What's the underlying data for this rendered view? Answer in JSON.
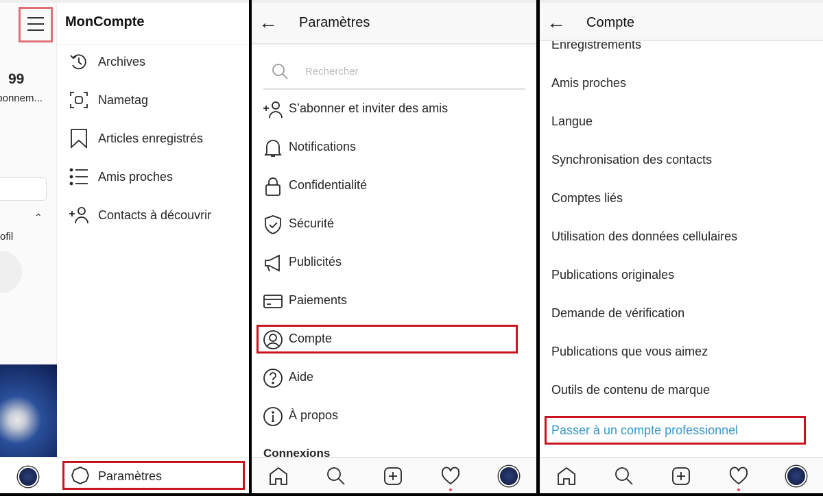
{
  "panel1": {
    "title": "MonCompte",
    "profile_count": "99",
    "profile_count_label": "bonnem...",
    "profile_partial_label": "ofil",
    "menu": [
      {
        "label": "Archives",
        "icon": "archive-history-icon"
      },
      {
        "label": "Nametag",
        "icon": "nametag-icon"
      },
      {
        "label": "Articles enregistrés",
        "icon": "bookmark-icon"
      },
      {
        "label": "Amis proches",
        "icon": "close-friends-list-icon"
      },
      {
        "label": "Contacts à découvrir",
        "icon": "add-person-icon"
      }
    ],
    "settings_label": "Paramètres"
  },
  "panel2": {
    "title": "Paramètres",
    "search_placeholder": "Rechercher",
    "menu": [
      {
        "label": "S’abonner et inviter des amis",
        "icon": "add-person-icon"
      },
      {
        "label": "Notifications",
        "icon": "bell-icon"
      },
      {
        "label": "Confidentialité",
        "icon": "lock-icon"
      },
      {
        "label": "Sécurité",
        "icon": "shield-icon"
      },
      {
        "label": "Publicités",
        "icon": "megaphone-icon"
      },
      {
        "label": "Paiements",
        "icon": "card-icon"
      },
      {
        "label": "Compte",
        "icon": "account-icon"
      },
      {
        "label": "Aide",
        "icon": "help-icon"
      },
      {
        "label": "À propos",
        "icon": "info-icon"
      }
    ],
    "section": "Connexions"
  },
  "panel3": {
    "title": "Compte",
    "menu": [
      "Enregistrements",
      "Amis proches",
      "Langue",
      "Synchronisation des contacts",
      "Comptes liés",
      "Utilisation des données cellulaires",
      "Publications originales",
      "Demande de vérification",
      "Publications que vous aimez",
      "Outils de contenu de marque"
    ],
    "pro_link": "Passer à un compte professionnel"
  },
  "colors": {
    "highlight": "#c8141e",
    "link": "#3897c8",
    "notification_dot": "#ed4956"
  }
}
